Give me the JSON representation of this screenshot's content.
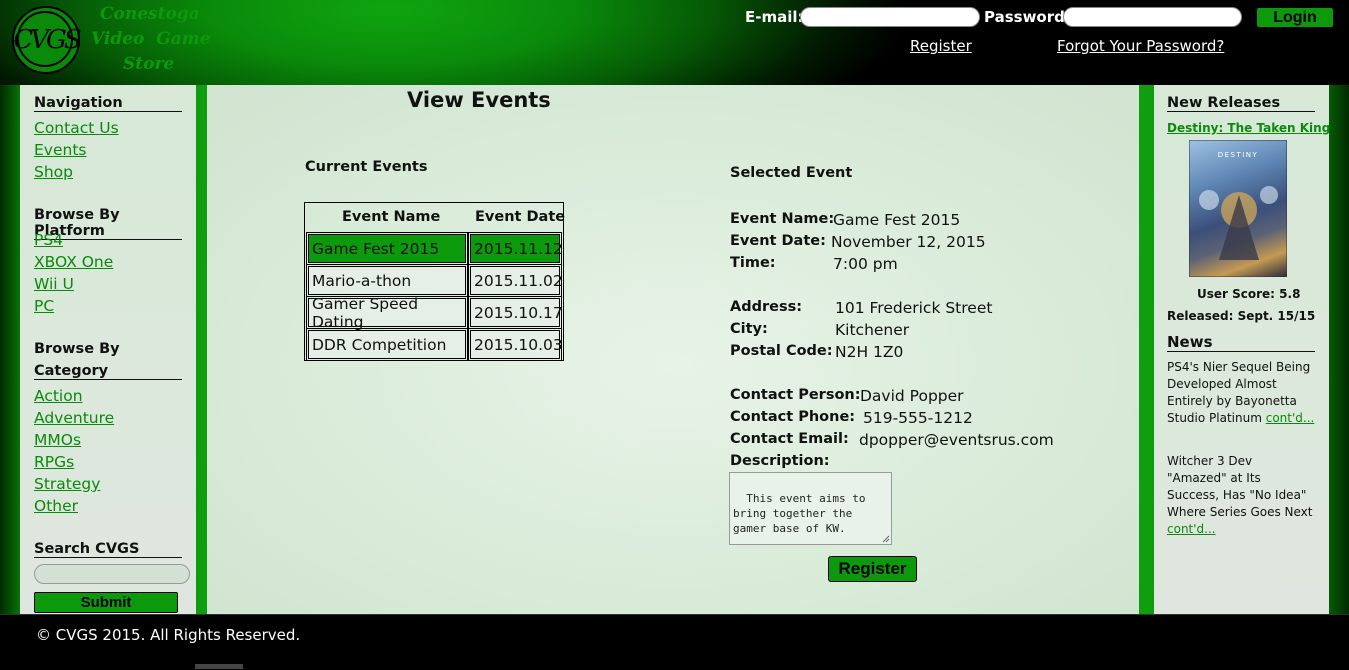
{
  "header": {
    "logo_mark": "CVGS",
    "logo_lines": [
      "Conestoga",
      "Video  Game",
      "Store"
    ],
    "email_label": "E-mail:",
    "email_value": "",
    "password_label": "Password:",
    "password_value": "",
    "login_label": "Login",
    "register_link": "Register",
    "forgot_link": "Forgot Your Password?"
  },
  "sidebar": {
    "navigation_title": "Navigation",
    "navigation_items": [
      "Contact Us",
      "Events",
      "Shop"
    ],
    "platform_title": "Browse By Platform",
    "platform_items": [
      "PS4",
      "XBOX One",
      "Wii U",
      "PC"
    ],
    "category_title_line1": "Browse By",
    "category_title_line2": "Category",
    "category_items": [
      "Action",
      "Adventure",
      "MMOs",
      "RPGs",
      "Strategy",
      "Other"
    ],
    "search_title": "Search CVGS",
    "search_value": "",
    "submit_label": "Submit"
  },
  "main": {
    "page_title": "View Events",
    "current_events_title": "Current Events",
    "table": {
      "headers": [
        "Event Name",
        "Event Date"
      ],
      "rows": [
        {
          "name": "Game Fest 2015",
          "date": "2015.11.12",
          "selected": true
        },
        {
          "name": "Mario-a-thon",
          "date": "2015.11.02",
          "selected": false
        },
        {
          "name": "Gamer Speed Dating",
          "date": "2015.10.17",
          "selected": false
        },
        {
          "name": "DDR Competition",
          "date": "2015.10.03",
          "selected": false
        }
      ]
    },
    "selected_title": "Selected Event",
    "details": {
      "event_name_label": "Event Name:",
      "event_name": "Game Fest 2015",
      "event_date_label": "Event Date:",
      "event_date": "November 12, 2015",
      "time_label": "Time:",
      "time": "7:00 pm",
      "address_label": "Address:",
      "address": "101 Frederick Street",
      "city_label": "City:",
      "city": "Kitchener",
      "postal_label": "Postal Code:",
      "postal": "N2H 1Z0",
      "contact_person_label": "Contact Person:",
      "contact_person": "David Popper",
      "contact_phone_label": "Contact Phone:",
      "contact_phone": "519-555-1212",
      "contact_email_label": "Contact Email:",
      "contact_email": "dpopper@eventsrus.com",
      "description_label": "Description:",
      "description": "This event aims to bring together the gamer base of KW."
    },
    "register_label": "Register"
  },
  "right": {
    "new_releases_title": "New Releases",
    "game_title": "Destiny: The Taken King",
    "user_score": "User Score: 5.8",
    "released": "Released: Sept. 15/15",
    "news_title": "News",
    "news": [
      {
        "text": "PS4's Nier Sequel Being Developed Almost Entirely by Bayonetta Studio Platinum ",
        "link": "cont'd..."
      },
      {
        "text": "Witcher 3 Dev \"Amazed\" at Its Success, Has \"No Idea\" Where Series Goes Next ",
        "link": "cont'd..."
      }
    ]
  },
  "footer": {
    "copyright": "© CVGS 2015. All Rights Reserved."
  },
  "colors": {
    "accent_green": "#0c9a0c",
    "link_green": "#0a8a0a",
    "panel_bg": "#d8ead8"
  }
}
